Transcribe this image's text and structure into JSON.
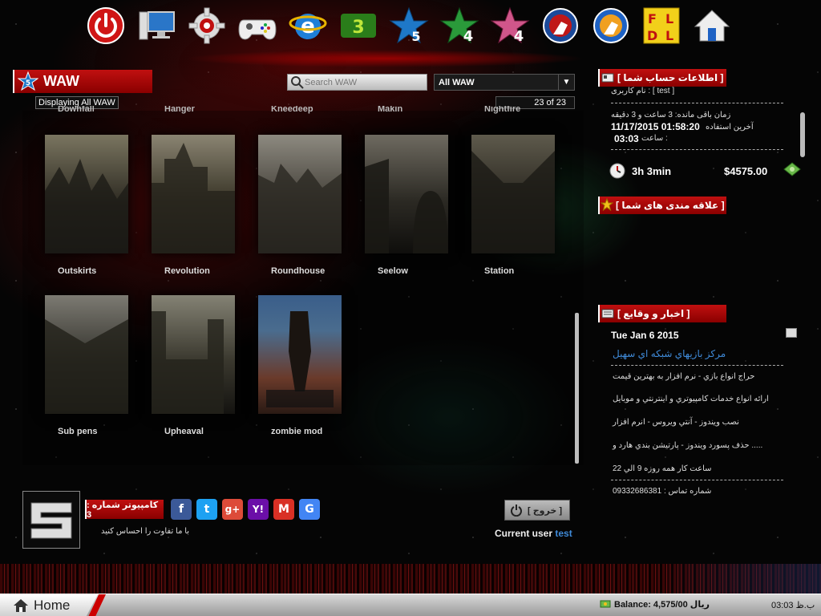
{
  "top_icons": [
    {
      "name": "power-icon",
      "label": ""
    },
    {
      "name": "computer-icon",
      "label": ""
    },
    {
      "name": "settings-gear-icon",
      "label": ""
    },
    {
      "name": "gamepad-icon",
      "label": ""
    },
    {
      "name": "internet-explorer-icon",
      "label": ""
    },
    {
      "name": "waw3-game-icon",
      "label": ""
    },
    {
      "name": "game-5-icon",
      "label": "5"
    },
    {
      "name": "game-4-green-icon",
      "label": "4"
    },
    {
      "name": "game-4-pink-icon",
      "label": "4"
    },
    {
      "name": "counter-strike-icon",
      "label": ""
    },
    {
      "name": "counter-strike-source-icon",
      "label": ""
    },
    {
      "name": "fldl-icon",
      "label": "FLDL"
    },
    {
      "name": "home-icon",
      "label": ""
    }
  ],
  "section": {
    "title": "WAW",
    "note": "Displaying All WAW"
  },
  "search": {
    "placeholder": "Search WAW"
  },
  "filter": {
    "selected": "All WAW"
  },
  "counter": "23 of 23",
  "clipped_labels": [
    "Downfall",
    "Hanger",
    "Kneedeep",
    "Makin",
    "Nightfire"
  ],
  "maps": [
    {
      "label": "Outskirts"
    },
    {
      "label": "Revolution"
    },
    {
      "label": "Roundhouse"
    },
    {
      "label": "Seelow"
    },
    {
      "label": "Station"
    },
    {
      "label": "Sub pens"
    },
    {
      "label": "Upheaval"
    },
    {
      "label": "zombie mod"
    }
  ],
  "account": {
    "header": "[ اطلاعات حساب شما ]",
    "username_line": "نام کاربری : [ test ]",
    "remaining_line": "زمان باقی مانده: 3 ساعت و 3 دقیقه",
    "last_use_label": "آخرین استفاده",
    "last_use_value": "11/17/2015 01:58:20",
    "time_label": "ساعت :",
    "time_value": "03:03",
    "hours": "3h 3min",
    "balance": "$4575.00"
  },
  "favorites": {
    "header": "[ علاقه مندی های شما ]"
  },
  "news": {
    "header": "[ اخبار و وقایع ]",
    "date": "Tue Jan 6 2015",
    "link": "مرکز بازيهاي شبکه اي سهيل",
    "lines": [
      "حراج انواع بازي - نرم افزار به بهترين قيمت",
      "ارائه انواع خدمات کامپيوتري و اينترنتي و موبايل",
      "نصب ويندوز - آنتي ويروس - انرم افزار",
      "حذف پسورد ويندوز - پارتيشن بندي هارد و .....",
      "ساعت کار همه روزه 9 الي 22",
      "شماره تماس : 09332686381"
    ]
  },
  "footer": {
    "computer_label": "کامپيوتر شماره : 3",
    "slogan": "با ما تفاوت را احساس کنيد",
    "logout_label": "[ خروج ]",
    "current_user_prefix": "Current user",
    "current_user": "test"
  },
  "socials": [
    {
      "name": "facebook-icon",
      "glyph": "f",
      "color": "#3b5998"
    },
    {
      "name": "twitter-icon",
      "glyph": "t",
      "color": "#1da1f2"
    },
    {
      "name": "google-plus-icon",
      "glyph": "g+",
      "color": "#dd4b39"
    },
    {
      "name": "yahoo-icon",
      "glyph": "Y!",
      "color": "#6b0fa8"
    },
    {
      "name": "gmail-icon",
      "glyph": "M",
      "color": "#d93025"
    },
    {
      "name": "google-icon",
      "glyph": "G",
      "color": "#4285f4"
    }
  ],
  "taskbar": {
    "home_label": "Home",
    "balance_label": "Balance: 4,575/00 ريال",
    "clock": "03:03 ب.ظ"
  },
  "colors": {
    "accent_red": "#c01010",
    "link_blue": "#3f8ad8"
  }
}
